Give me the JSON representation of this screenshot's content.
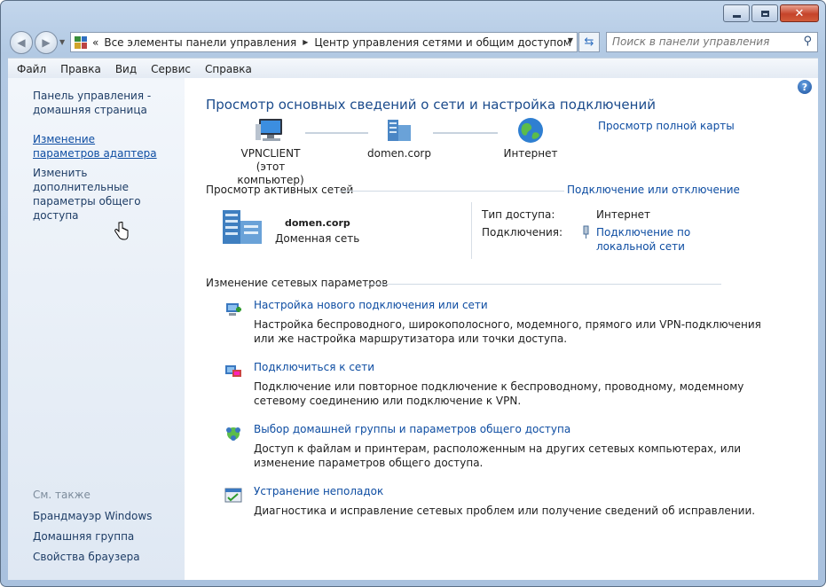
{
  "window": {
    "caption_buttons": {
      "minimize": "minimize",
      "maximize": "maximize",
      "close": "✕"
    }
  },
  "address": {
    "prefix": "«",
    "crumbs": [
      "Все элементы панели управления",
      "Центр управления сетями и общим доступом"
    ],
    "separator": "▶"
  },
  "search": {
    "placeholder": "Поиск в панели управления"
  },
  "menu": [
    "Файл",
    "Правка",
    "Вид",
    "Сервис",
    "Справка"
  ],
  "sidebar": {
    "links": [
      {
        "text": "Панель управления - домашняя страница"
      },
      {
        "text": "Изменение параметров адаптера"
      },
      {
        "text": "Изменить дополнительные параметры общего доступа"
      }
    ],
    "see_also_label": "См. также",
    "see_also": [
      "Брандмауэр Windows",
      "Домашняя группа",
      "Свойства браузера"
    ]
  },
  "main": {
    "help": "?",
    "title": "Просмотр основных сведений о сети и настройка подключений",
    "full_map_link": "Просмотр полной карты",
    "map": {
      "nodes": [
        {
          "name": "VPNCLIENT",
          "sub": "(этот компьютер)"
        },
        {
          "name": "domen.corp",
          "sub": ""
        },
        {
          "name": "Интернет",
          "sub": ""
        }
      ]
    },
    "active_networks": {
      "header": "Просмотр активных сетей",
      "connect_link": "Подключение или отключение",
      "network_name": "domen.corp",
      "network_type": "Доменная сеть",
      "access_type_label": "Тип доступа:",
      "access_type_value": "Интернет",
      "connections_label": "Подключения:",
      "connections_value": "Подключение по локальной сети"
    },
    "change_settings": {
      "header": "Изменение сетевых параметров",
      "tasks": [
        {
          "title": "Настройка нового подключения или сети",
          "desc_line1": "Настройка беспроводного, широкополосного, модемного, прямого или VPN-подключения",
          "desc_line2": "или же настройка маршрутизатора или точки доступа."
        },
        {
          "title": "Подключиться к сети",
          "desc_line1": "Подключение или повторное подключение к беспроводному, проводному, модемному",
          "desc_line2": "сетевому соединению или подключение к VPN."
        },
        {
          "title": "Выбор домашней группы и параметров общего доступа",
          "desc_line1": "Доступ к файлам и принтерам, расположенным на других сетевых компьютерах, или",
          "desc_line2": "изменение параметров общего доступа."
        },
        {
          "title": "Устранение неполадок",
          "desc_line1": "Диагностика и исправление сетевых проблем или получение сведений об исправлении.",
          "desc_line2": ""
        }
      ]
    }
  },
  "colors": {
    "link": "#0e4da2",
    "title": "#1b4b8c",
    "frame": "#b2c9e3"
  }
}
